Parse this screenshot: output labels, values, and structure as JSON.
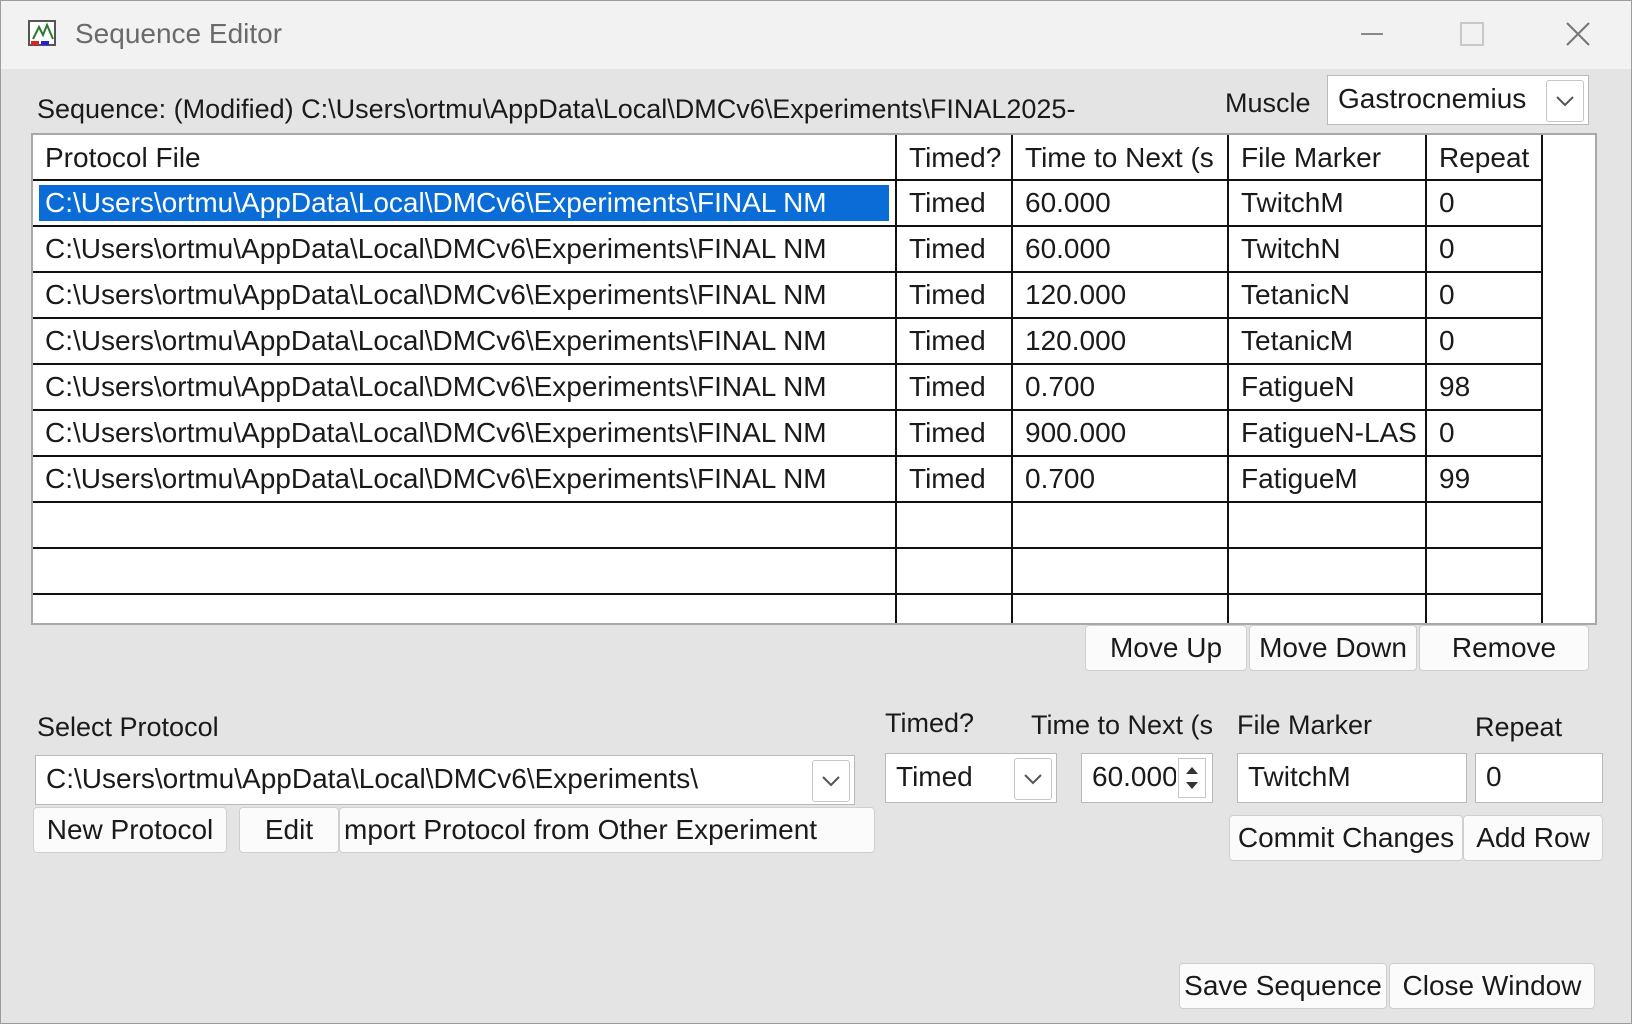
{
  "window": {
    "title": "Sequence Editor",
    "controls": {
      "minimize": "minimize-icon",
      "maximize": "maximize-icon",
      "close": "close-icon"
    }
  },
  "sequence_label": "Sequence: (Modified) C:\\Users\\ortmu\\AppData\\Local\\DMCv6\\Experiments\\FINAL2025-",
  "muscle": {
    "label": "Muscle",
    "value": "Gastrocnemius"
  },
  "table": {
    "headers": [
      "Protocol File",
      "Timed?",
      "Time to Next (s",
      "File Marker",
      "Repeat"
    ],
    "rows": [
      [
        "C:\\Users\\ortmu\\AppData\\Local\\DMCv6\\Experiments\\FINAL NM",
        "Timed",
        "60.000",
        "TwitchM",
        "0"
      ],
      [
        "C:\\Users\\ortmu\\AppData\\Local\\DMCv6\\Experiments\\FINAL NM",
        "Timed",
        "60.000",
        "TwitchN",
        "0"
      ],
      [
        "C:\\Users\\ortmu\\AppData\\Local\\DMCv6\\Experiments\\FINAL NM",
        "Timed",
        "120.000",
        "TetanicN",
        "0"
      ],
      [
        "C:\\Users\\ortmu\\AppData\\Local\\DMCv6\\Experiments\\FINAL NM",
        "Timed",
        "120.000",
        "TetanicM",
        "0"
      ],
      [
        "C:\\Users\\ortmu\\AppData\\Local\\DMCv6\\Experiments\\FINAL NM",
        "Timed",
        "0.700",
        "FatigueN",
        "98"
      ],
      [
        "C:\\Users\\ortmu\\AppData\\Local\\DMCv6\\Experiments\\FINAL NM",
        "Timed",
        "900.000",
        "FatigueN-LAS",
        "0"
      ],
      [
        "C:\\Users\\ortmu\\AppData\\Local\\DMCv6\\Experiments\\FINAL NM",
        "Timed",
        "0.700",
        "FatigueM",
        "99"
      ]
    ],
    "empty_rows": 3
  },
  "row_buttons": {
    "move_up": "Move Up",
    "move_down": "Move Down",
    "remove": "Remove"
  },
  "editor": {
    "select_protocol_label": "Select Protocol",
    "protocol_value": "C:\\Users\\ortmu\\AppData\\Local\\DMCv6\\Experiments\\",
    "timed_label": "Timed?",
    "timed_value": "Timed",
    "time_label": "Time to Next (s",
    "time_value": "60.000",
    "marker_label": "File Marker",
    "marker_value": "TwitchM",
    "repeat_label": "Repeat",
    "repeat_value": "0"
  },
  "protocol_buttons": {
    "new_protocol": "New Protocol",
    "edit": "Edit",
    "import": "mport Protocol from Other Experiment"
  },
  "commit_buttons": {
    "commit": "Commit Changes",
    "add_row": "Add Row"
  },
  "footer_buttons": {
    "save": "Save Sequence",
    "close": "Close Window"
  },
  "colors": {
    "selection": "#0a6cd6",
    "window_bg": "#e4e4e4",
    "titlebar_bg": "#f2f2f2"
  }
}
